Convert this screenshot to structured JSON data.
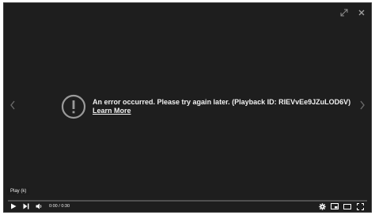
{
  "error": {
    "message": "An error occurred. Please try again later. (Playback ID: RIEVvEe9JZuLOD6V)",
    "link": "Learn More"
  },
  "tooltip": {
    "text": "Play (k)"
  },
  "controls": {
    "time_current": "0:00",
    "time_sep": " / ",
    "time_total": "0:30",
    "progress": 0.0
  },
  "icons": {
    "fullscreen_top": "expand-diagonal-icon",
    "close": "close-icon",
    "prev_arrow": "chevron-left-icon",
    "next_arrow": "chevron-right-icon",
    "error": "exclamation-circle-icon",
    "play": "play-icon",
    "next": "skip-next-icon",
    "volume": "volume-icon",
    "settings": "gear-icon",
    "miniplayer": "miniplayer-icon",
    "theater": "theater-mode-icon",
    "fullscreen": "fullscreen-icon"
  },
  "colors": {
    "background": "#1e1e1e",
    "progress_played": "#cc0000"
  }
}
